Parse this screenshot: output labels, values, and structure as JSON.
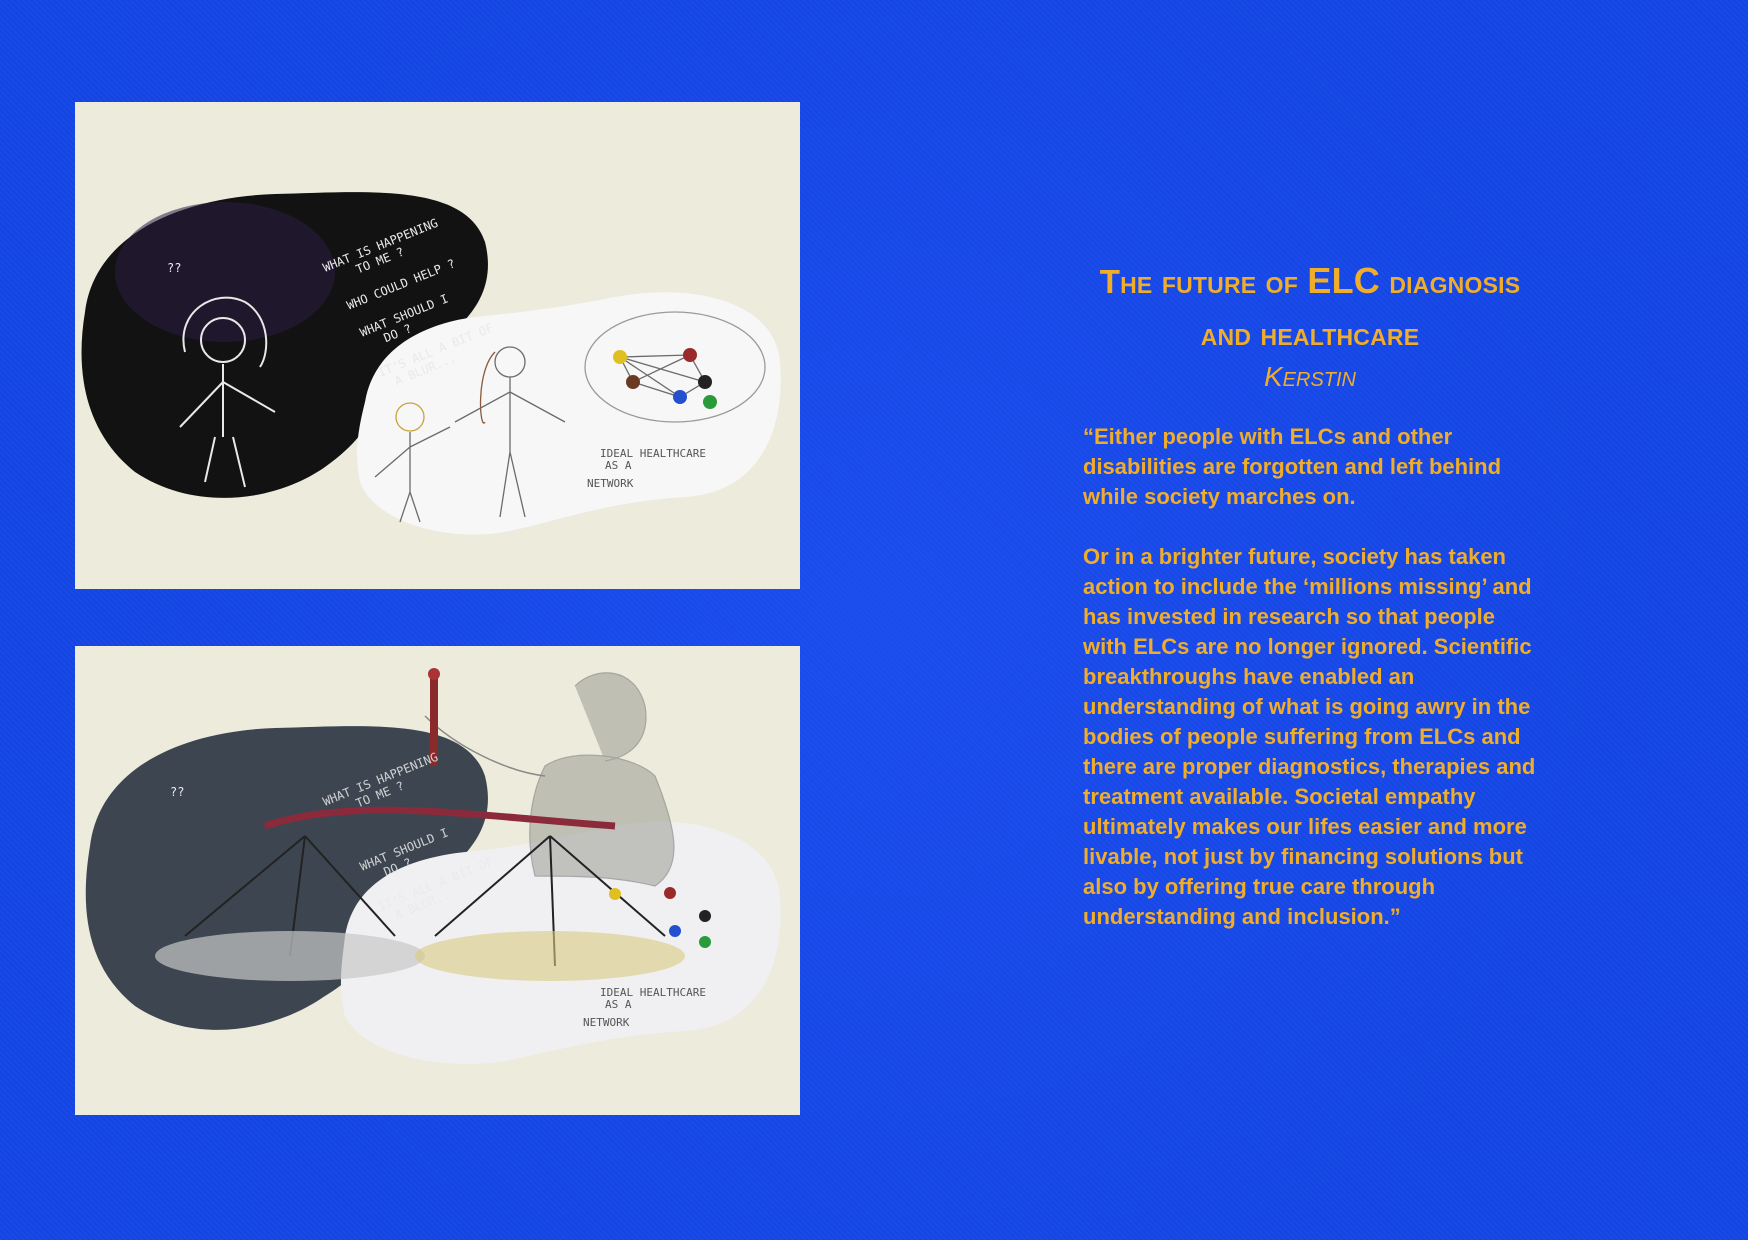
{
  "title": {
    "line1_prefix": "The future of",
    "line1_emph": "ELC",
    "line1_suffix": "diagnosis",
    "line2": "and healthcare"
  },
  "author": "Kerstin",
  "quote": {
    "paragraph1": "“Either people with ELCs and other disabilities are forgotten and left behind while society marches on.",
    "paragraph2": "Or in a brighter future, society has taken action to include the ‘millions missing’ and has invested in research so that people with ELCs are no longer ignored. Scientific breakthroughs have enabled an understanding of what is going awry in the bodies of people suffering from ELCs and there are proper diagnostics, therapies and treatment available. Societal empathy ultimately makes our lifes easier and more livable, not just by financing solutions but also by offering true care through understanding and inclusion.”"
  },
  "drawing": {
    "question_marks": "??",
    "chalk_lines": [
      "WHAT IS HAPPENING",
      "TO ME ?",
      "WHO COULD HELP ?",
      "WHAT SHOULD I",
      "DO ?",
      "IT'S ALL A BIT OF",
      "A BLUR..."
    ],
    "network_caption": [
      "IDEAL HEALTHCARE",
      "AS A"
    ],
    "network_word": "NETWORK"
  },
  "colors": {
    "background": "#1446e6",
    "accent_text": "#f0ad2a",
    "paper": "#ecebdc",
    "chalkboard": "#121212"
  }
}
